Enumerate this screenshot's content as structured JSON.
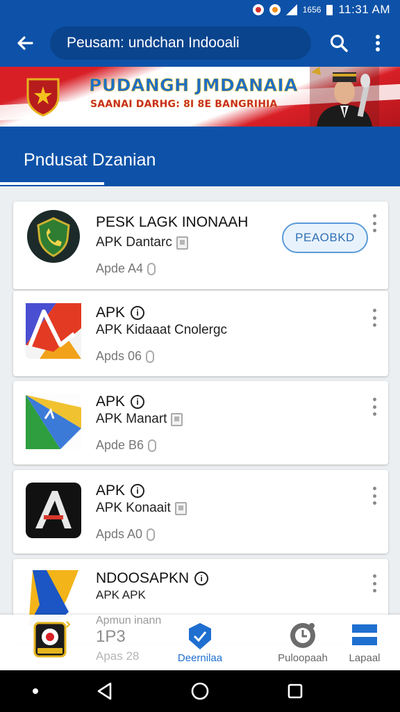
{
  "status_bar": {
    "small_text": "1656",
    "time": "11:31 AM"
  },
  "app_bar": {
    "search_text": "Peusam: undchan Indooali",
    "back_icon": "arrow-left-icon",
    "search_icon": "search-icon",
    "more_icon": "more-vert-icon"
  },
  "banner": {
    "title": "PUDANGH JMDANAIA",
    "subtitle": "SAANAI DARHG: 8I 8E BANGRIHIA"
  },
  "section": {
    "tab_label": "Pndusat Dzanian"
  },
  "apps": [
    {
      "name": "PESK LAGK INONAAH",
      "sub": "APK Dantarc",
      "meta": "Apde A4",
      "button": "PEAOBKD",
      "info": false
    },
    {
      "name": "APK",
      "sub": "APK Kidaaat Cnolergc",
      "meta": "Apds 06",
      "info": true
    },
    {
      "name": "APK",
      "sub": "APK Manart",
      "meta": "Apde B6",
      "info": true
    },
    {
      "name": "APK",
      "sub": "APK Konaait",
      "meta": "Apds A0",
      "info": true
    },
    {
      "name": "NDOOSAPKN",
      "sub": "APK APK",
      "meta": "",
      "info": true
    }
  ],
  "bottom_nav": {
    "overlap_text_1": "Apmun inann",
    "overlap_text_2": "1P3",
    "overlap_text_3": "Apas 28",
    "items": [
      {
        "label": ""
      },
      {
        "label": "Deernilaa"
      },
      {
        "label": "Puloopaah"
      },
      {
        "label": "Lapaal"
      }
    ]
  },
  "colors": {
    "primary": "#0d52a8",
    "accent": "#1e6fd0",
    "banner_red": "#d81f26"
  }
}
